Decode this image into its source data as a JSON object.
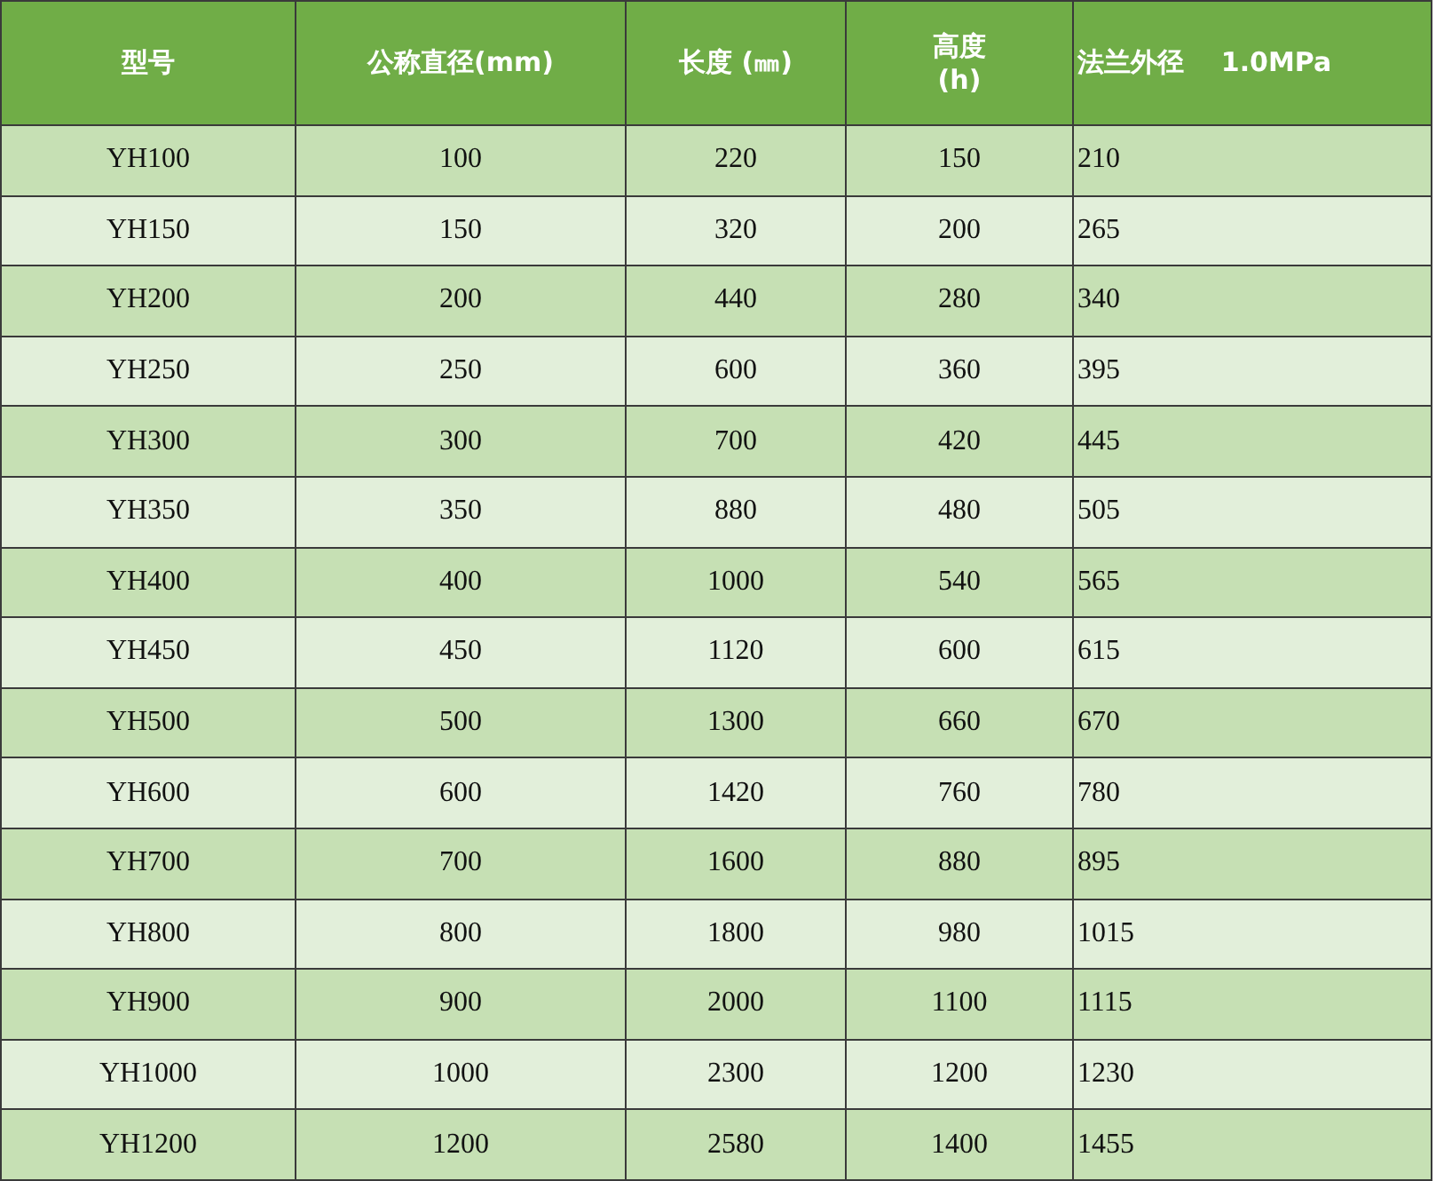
{
  "table": {
    "columns": [
      "型号",
      "公称直径(mm)",
      "长度    (㎜)",
      "高度\n(h)",
      "法兰外径    1.0MPa"
    ],
    "rows": [
      [
        "YH100",
        "100",
        "220",
        "150",
        "210"
      ],
      [
        "YH150",
        "150",
        "320",
        "200",
        "265"
      ],
      [
        "YH200",
        "200",
        "440",
        "280",
        "340"
      ],
      [
        "YH250",
        "250",
        "600",
        "360",
        "395"
      ],
      [
        "YH300",
        "300",
        "700",
        "420",
        "445"
      ],
      [
        "YH350",
        "350",
        "880",
        "480",
        "505"
      ],
      [
        "YH400",
        "400",
        "1000",
        "540",
        "565"
      ],
      [
        "YH450",
        "450",
        "1120",
        "600",
        "615"
      ],
      [
        "YH500",
        "500",
        "1300",
        "660",
        "670"
      ],
      [
        "YH600",
        "600",
        "1420",
        "760",
        "780"
      ],
      [
        "YH700",
        "700",
        "1600",
        "880",
        "895"
      ],
      [
        "YH800",
        "800",
        "1800",
        "980",
        "1015"
      ],
      [
        "YH900",
        "900",
        "2000",
        "1100",
        "1115"
      ],
      [
        "YH1000",
        "1000",
        "2300",
        "1200",
        "1230"
      ],
      [
        "YH1200",
        "1200",
        "2580",
        "1400",
        "1455"
      ]
    ]
  }
}
